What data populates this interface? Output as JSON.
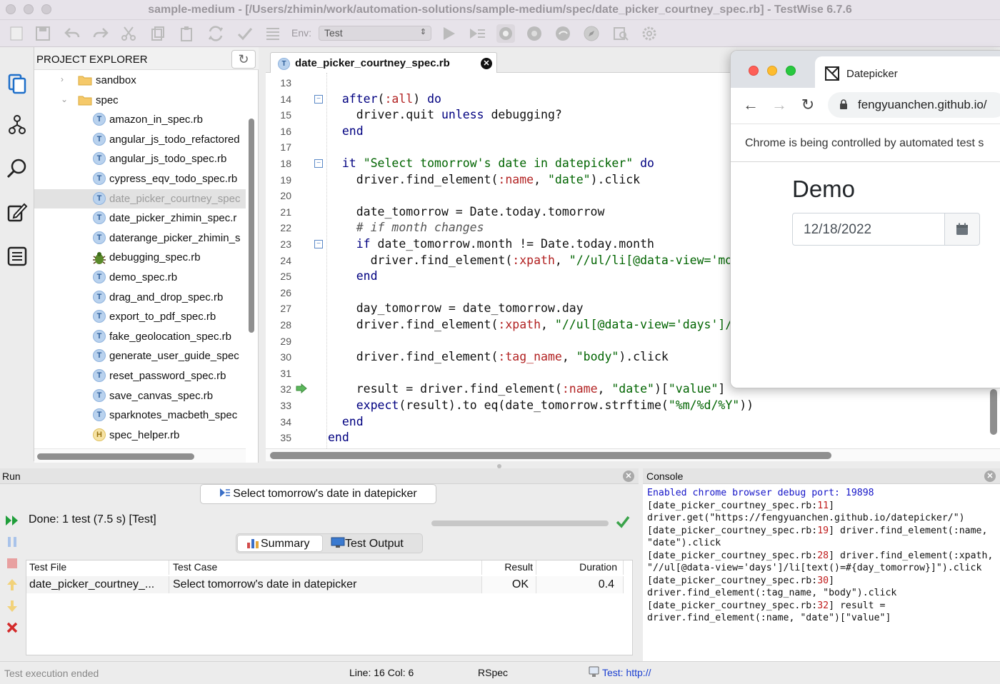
{
  "window": {
    "title": "sample-medium - [/Users/zhimin/work/automation-solutions/sample-medium/spec/date_picker_courtney_spec.rb] - TestWise 6.7.6"
  },
  "toolbar": {
    "env_label": "Env:",
    "env_value": "Test",
    "icons": [
      "new-file-icon",
      "save-icon",
      "undo-icon",
      "redo-icon",
      "cut-icon",
      "copy-icon",
      "paste-icon",
      "refresh-icon",
      "check-icon",
      "list-icon",
      "run-icon",
      "run-all-icon",
      "record-icon",
      "chrome-icon",
      "edge-icon",
      "safari-icon",
      "inspect-icon",
      "gear-icon"
    ]
  },
  "rail": {
    "icons": [
      "files-icon",
      "branch-icon",
      "search-icon",
      "edit-icon",
      "list-icon"
    ]
  },
  "explorer": {
    "title": "PROJECT EXPLORER",
    "folders": [
      {
        "label": "sandbox",
        "expanded": false
      },
      {
        "label": "spec",
        "expanded": true
      }
    ],
    "files": [
      {
        "label": "amazon_in_spec.rb",
        "type": "T"
      },
      {
        "label": "angular_js_todo_refactored",
        "type": "T"
      },
      {
        "label": "angular_js_todo_spec.rb",
        "type": "T"
      },
      {
        "label": "cypress_eqv_todo_spec.rb",
        "type": "T"
      },
      {
        "label": "date_picker_courtney_spec",
        "type": "T",
        "selected": true
      },
      {
        "label": "date_picker_zhimin_spec.r",
        "type": "T"
      },
      {
        "label": "daterange_picker_zhimin_s",
        "type": "T"
      },
      {
        "label": "debugging_spec.rb",
        "type": "bug"
      },
      {
        "label": "demo_spec.rb",
        "type": "T"
      },
      {
        "label": "drag_and_drop_spec.rb",
        "type": "T"
      },
      {
        "label": "export_to_pdf_spec.rb",
        "type": "T"
      },
      {
        "label": "fake_geolocation_spec.rb",
        "type": "T"
      },
      {
        "label": "generate_user_guide_spec",
        "type": "T"
      },
      {
        "label": "reset_password_spec.rb",
        "type": "T"
      },
      {
        "label": "save_canvas_spec.rb",
        "type": "T"
      },
      {
        "label": "sparknotes_macbeth_spec",
        "type": "T"
      },
      {
        "label": "spec_helper.rb",
        "type": "H"
      }
    ]
  },
  "editor": {
    "tab_label": "date_picker_courtney_spec.rb",
    "tab_icon_letter": "T",
    "line_numbers": [
      "13",
      "14",
      "15",
      "16",
      "17",
      "18",
      "19",
      "20",
      "21",
      "22",
      "23",
      "24",
      "25",
      "26",
      "27",
      "28",
      "29",
      "30",
      "31",
      "32",
      "33",
      "34",
      "35"
    ],
    "lines": [
      [],
      [
        {
          "t": "  "
        },
        {
          "t": "after",
          "c": "kw"
        },
        {
          "t": "("
        },
        {
          "t": ":all",
          "c": "sym"
        },
        {
          "t": ") "
        },
        {
          "t": "do",
          "c": "kw"
        }
      ],
      [
        {
          "t": "    driver.quit "
        },
        {
          "t": "unless",
          "c": "kw"
        },
        {
          "t": " debugging?"
        }
      ],
      [
        {
          "t": "  "
        },
        {
          "t": "end",
          "c": "kw"
        }
      ],
      [],
      [
        {
          "t": "  "
        },
        {
          "t": "it",
          "c": "kw"
        },
        {
          "t": " "
        },
        {
          "t": "\"Select tomorrow's date in datepicker\"",
          "c": "str"
        },
        {
          "t": " "
        },
        {
          "t": "do",
          "c": "kw"
        }
      ],
      [
        {
          "t": "    driver.find_element("
        },
        {
          "t": ":name",
          "c": "sym"
        },
        {
          "t": ", "
        },
        {
          "t": "\"date\"",
          "c": "str"
        },
        {
          "t": ").click"
        }
      ],
      [],
      [
        {
          "t": "    date_tomorrow = Date.today.tomorrow"
        }
      ],
      [
        {
          "t": "    # if month changes",
          "c": "cmt"
        }
      ],
      [
        {
          "t": "    "
        },
        {
          "t": "if",
          "c": "kw"
        },
        {
          "t": " date_tomorrow.month != Date.today.month"
        }
      ],
      [
        {
          "t": "      driver.find_element("
        },
        {
          "t": ":xpath",
          "c": "sym"
        },
        {
          "t": ", "
        },
        {
          "t": "\"//ul/li[@data-view='mon",
          "c": "str"
        }
      ],
      [
        {
          "t": "    "
        },
        {
          "t": "end",
          "c": "kw"
        }
      ],
      [],
      [
        {
          "t": "    day_tomorrow = date_tomorrow.day"
        }
      ],
      [
        {
          "t": "    driver.find_element("
        },
        {
          "t": ":xpath",
          "c": "sym"
        },
        {
          "t": ", "
        },
        {
          "t": "\"//ul[@data-view='days']/l",
          "c": "str"
        }
      ],
      [],
      [
        {
          "t": "    driver.find_element("
        },
        {
          "t": ":tag_name",
          "c": "sym"
        },
        {
          "t": ", "
        },
        {
          "t": "\"body\"",
          "c": "str"
        },
        {
          "t": ").click"
        }
      ],
      [],
      [
        {
          "t": "    result = driver.find_element("
        },
        {
          "t": ":name",
          "c": "sym"
        },
        {
          "t": ", "
        },
        {
          "t": "\"date\"",
          "c": "str"
        },
        {
          "t": ")["
        },
        {
          "t": "\"value\"",
          "c": "str"
        },
        {
          "t": "]"
        }
      ],
      [
        {
          "t": "    "
        },
        {
          "t": "expect",
          "c": "kw"
        },
        {
          "t": "(result).to eq(date_tomorrow.strftime("
        },
        {
          "t": "\"%m/%d/%Y\"",
          "c": "str"
        },
        {
          "t": "))"
        }
      ],
      [
        {
          "t": "  "
        },
        {
          "t": "end",
          "c": "kw"
        }
      ],
      [
        {
          "t": "end",
          "c": "kw"
        }
      ]
    ],
    "fold_lines": [
      "14",
      "18",
      "23"
    ],
    "current_exec_line": "32"
  },
  "chrome": {
    "tab_label": "Datepicker",
    "url": "fengyuanchen.github.io/",
    "infobar": "Chrome is being controlled by automated test s",
    "page_title": "Demo",
    "date_value": "12/18/2022"
  },
  "run": {
    "title": "Run",
    "target_button": "Select tomorrow's date in datepicker",
    "done_text": "Done: 1 test (7.5 s) [Test]",
    "progress_fraction": 1.0,
    "tabs": {
      "summary": "Summary",
      "test_output": "Test Output"
    },
    "columns": [
      "Test File",
      "Test Case",
      "Result",
      "Duration"
    ],
    "rows": [
      {
        "test_file": "date_picker_courtney_...",
        "test_case": "Select tomorrow's date in datepicker",
        "result": "OK",
        "duration": "0.4"
      }
    ]
  },
  "console": {
    "title": "Console",
    "lines": [
      [
        {
          "t": "Enabled chrome browser debug port: 19898",
          "c": "c-blue"
        }
      ],
      [
        {
          "t": "[date_picker_courtney_spec.rb:"
        },
        {
          "t": "11",
          "c": "c-red"
        },
        {
          "t": "]"
        }
      ],
      [
        {
          "t": "driver.get(\"https://fengyuanchen.github.io/datepicker/\")"
        }
      ],
      [
        {
          "t": "[date_picker_courtney_spec.rb:"
        },
        {
          "t": "19",
          "c": "c-red"
        },
        {
          "t": "] driver.find_element(:name,"
        }
      ],
      [
        {
          "t": "\"date\").click"
        }
      ],
      [
        {
          "t": "[date_picker_courtney_spec.rb:"
        },
        {
          "t": "28",
          "c": "c-red"
        },
        {
          "t": "] driver.find_element(:xpath,"
        }
      ],
      [
        {
          "t": "\"//ul[@data-view='days']/li[text()=#{day_tomorrow}]\").click"
        }
      ],
      [
        {
          "t": "[date_picker_courtney_spec.rb:"
        },
        {
          "t": "30",
          "c": "c-red"
        },
        {
          "t": "]"
        }
      ],
      [
        {
          "t": "driver.find_element(:tag_name, \"body\").click"
        }
      ],
      [
        {
          "t": "[date_picker_courtney_spec.rb:"
        },
        {
          "t": "32",
          "c": "c-red"
        },
        {
          "t": "] result ="
        }
      ],
      [
        {
          "t": "driver.find_element(:name, \"date\")[\"value\"]"
        }
      ]
    ]
  },
  "status": {
    "left": "Test execution ended",
    "line_col": "Line: 16  Col: 6",
    "framework": "RSpec",
    "test_url": "Test: http://"
  }
}
